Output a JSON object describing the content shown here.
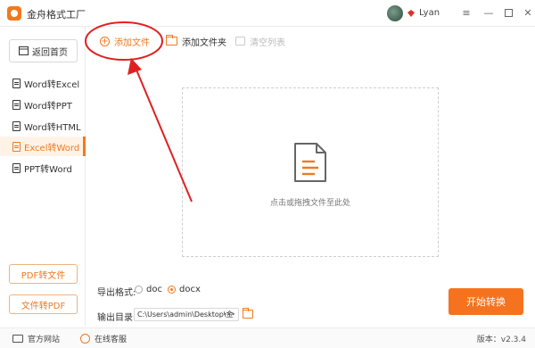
{
  "app": {
    "title": "金舟格式工厂"
  },
  "user": {
    "name": "Lyan"
  },
  "sidebar": {
    "back_label": "返回首页",
    "items": [
      {
        "label": "Word转Excel",
        "active": false
      },
      {
        "label": "Word转PPT",
        "active": false
      },
      {
        "label": "Word转HTML",
        "active": false
      },
      {
        "label": "Excel转Word",
        "active": true
      },
      {
        "label": "PPT转Word",
        "active": false
      }
    ],
    "pdf_to_file_label": "PDF转文件",
    "file_to_pdf_label": "文件转PDF"
  },
  "toolbar": {
    "add_file_label": "添加文件",
    "add_folder_label": "添加文件夹",
    "clear_list_label": "清空列表"
  },
  "dropzone": {
    "hint": "点击或拖拽文件至此处"
  },
  "output": {
    "format_label": "导出格式:",
    "formats": [
      {
        "label": "doc",
        "selected": false
      },
      {
        "label": "docx",
        "selected": true
      }
    ],
    "dir_label": "输出目录:",
    "dir_value": "C:\\Users\\admin\\Desktop\\金",
    "dir_more": "•••",
    "start_label": "开始转换"
  },
  "statusbar": {
    "website_label": "官方网站",
    "support_label": "在线客服",
    "version": "版本：v2.3.4"
  },
  "colors": {
    "accent": "#f07a1f",
    "annotation": "#e02020"
  }
}
